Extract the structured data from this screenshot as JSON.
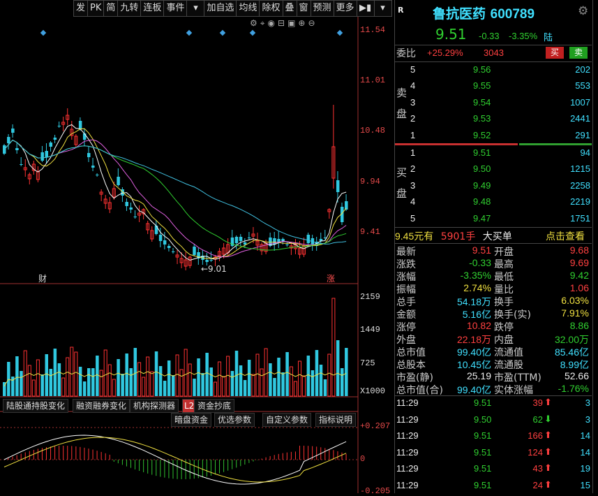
{
  "toolbar": {
    "items": [
      "发",
      "PK",
      "简",
      "九转",
      "连板",
      "事件",
      "加自选",
      "均线",
      "除权",
      "叠",
      "窗",
      "预测",
      "更多"
    ]
  },
  "chart": {
    "price_ticks": [
      "11.54",
      "11.01",
      "10.48",
      "9.94",
      "9.41"
    ],
    "min_label": "←9.01",
    "marker_cai": "财",
    "marker_zhang": "涨",
    "vol_ticks": [
      "2159",
      "1449",
      "725",
      "X1000"
    ],
    "macd_ticks": [
      "+0.207",
      "0",
      "-0.205"
    ]
  },
  "bottom_tabs": [
    "陆股通持股变化",
    "融资融券变化",
    "机构探测器",
    "L2",
    "资金抄底"
  ],
  "sub_tabs": [
    "暗盘资金",
    "优选参数",
    "自定义参数",
    "指标说明"
  ],
  "stock": {
    "badge": "R",
    "name": "鲁抗医药",
    "code": "600789",
    "price": "9.51",
    "change": "-0.33",
    "change_pct": "-3.35%",
    "exchange": "陆"
  },
  "weibi": {
    "label": "委比",
    "pct": "+25.29%",
    "diff": "3043",
    "buy": "买",
    "sell": "卖"
  },
  "sell_label": [
    "卖",
    "盘"
  ],
  "buy_label": [
    "买",
    "盘"
  ],
  "asks": [
    {
      "level": "5",
      "price": "9.56",
      "vol": "202"
    },
    {
      "level": "4",
      "price": "9.55",
      "vol": "553"
    },
    {
      "level": "3",
      "price": "9.54",
      "vol": "1007"
    },
    {
      "level": "2",
      "price": "9.53",
      "vol": "2441"
    },
    {
      "level": "1",
      "price": "9.52",
      "vol": "291"
    }
  ],
  "bids": [
    {
      "level": "1",
      "price": "9.51",
      "vol": "94"
    },
    {
      "level": "2",
      "price": "9.50",
      "vol": "1215"
    },
    {
      "level": "3",
      "price": "9.49",
      "vol": "2258"
    },
    {
      "level": "4",
      "price": "9.48",
      "vol": "2219"
    },
    {
      "level": "5",
      "price": "9.47",
      "vol": "1751"
    }
  ],
  "big_order": {
    "price": "9.45",
    "unit": "元有",
    "qty": "5901手",
    "type": "大买单",
    "link": "点击查看"
  },
  "stats": [
    {
      "l1": "最新",
      "v1": "9.51",
      "c1": "red",
      "l2": "开盘",
      "v2": "9.68",
      "c2": "red"
    },
    {
      "l1": "涨跌",
      "v1": "-0.33",
      "c1": "green",
      "l2": "最高",
      "v2": "9.69",
      "c2": "red"
    },
    {
      "l1": "涨幅",
      "v1": "-3.35%",
      "c1": "green",
      "l2": "最低",
      "v2": "9.42",
      "c2": "green"
    },
    {
      "l1": "振幅",
      "v1": "2.74%",
      "c1": "yellow",
      "l2": "量比",
      "v2": "1.06",
      "c2": "red"
    },
    {
      "l1": "总手",
      "v1": "54.18万",
      "c1": "cyan",
      "l2": "换手",
      "v2": "6.03%",
      "c2": "yellow"
    },
    {
      "l1": "金额",
      "v1": "5.16亿",
      "c1": "cyan",
      "l2": "换手(实)",
      "v2": "7.91%",
      "c2": "yellow"
    },
    {
      "l1": "涨停",
      "v1": "10.82",
      "c1": "red",
      "l2": "跌停",
      "v2": "8.86",
      "c2": "green"
    },
    {
      "l1": "外盘",
      "v1": "22.18万",
      "c1": "red",
      "l2": "内盘",
      "v2": "32.00万",
      "c2": "green"
    },
    {
      "l1": "总市值",
      "v1": "99.40亿",
      "c1": "cyan",
      "l2": "流通值",
      "v2": "85.46亿",
      "c2": "cyan"
    },
    {
      "l1": "总股本",
      "v1": "10.45亿",
      "c1": "cyan",
      "l2": "流通股",
      "v2": "8.99亿",
      "c2": "cyan"
    },
    {
      "l1": "市盈(静)",
      "v1": "25.19",
      "c1": "white",
      "l2": "市盈(TTM)",
      "v2": "52.66",
      "c2": "white"
    },
    {
      "l1": "总市值(合)",
      "v1": "99.40亿",
      "c1": "cyan",
      "l2": "实体涨幅",
      "v2": "-1.76%",
      "c2": "green"
    }
  ],
  "ticks": [
    {
      "time": "11:29",
      "price": "9.51",
      "vol": "39",
      "dir": "up",
      "n": "3"
    },
    {
      "time": "11:29",
      "price": "9.50",
      "vol": "62",
      "dir": "down",
      "n": "3"
    },
    {
      "time": "11:29",
      "price": "9.51",
      "vol": "166",
      "dir": "up",
      "n": "14"
    },
    {
      "time": "11:29",
      "price": "9.51",
      "vol": "124",
      "dir": "up",
      "n": "14"
    },
    {
      "time": "11:29",
      "price": "9.51",
      "vol": "43",
      "dir": "up",
      "n": "19"
    },
    {
      "time": "11:29",
      "price": "9.51",
      "vol": "24",
      "dir": "up",
      "n": "15"
    }
  ],
  "colors": {
    "up": "#ff3232",
    "down": "#30c8e0",
    "accent": "#40e0ff"
  }
}
